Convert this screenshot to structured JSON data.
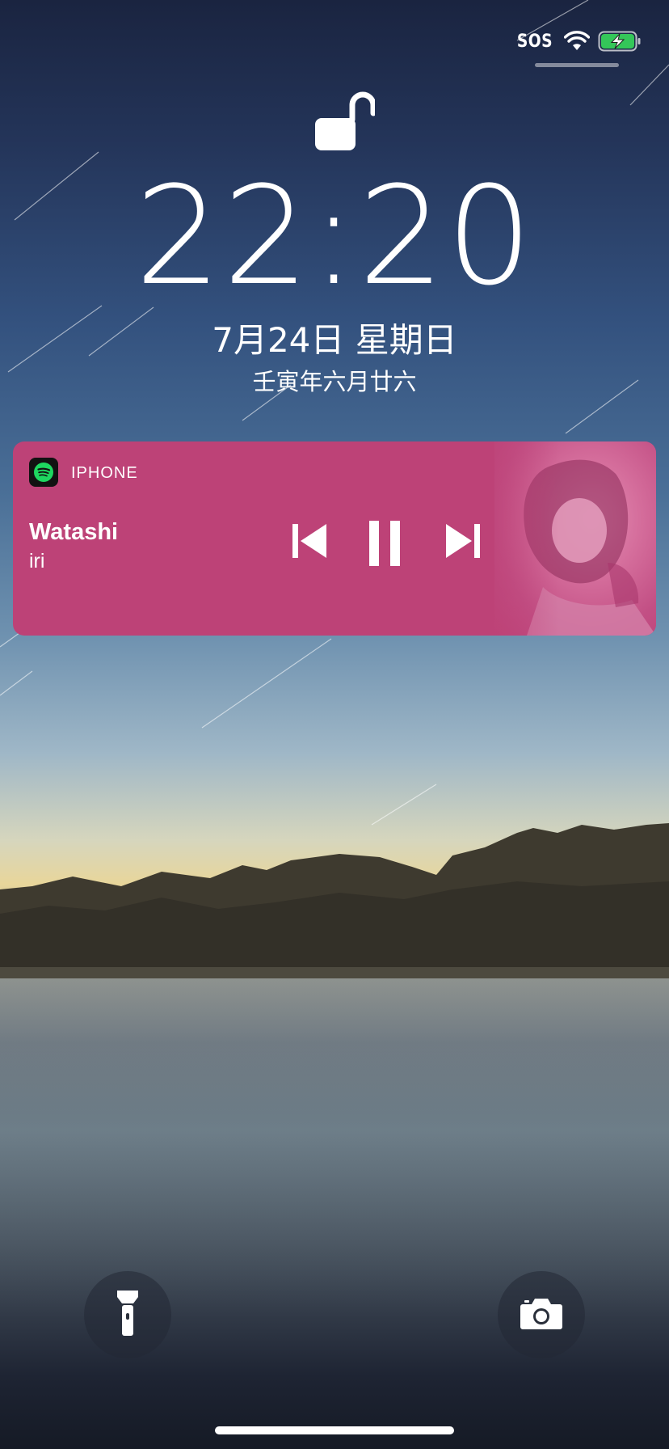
{
  "status_bar": {
    "carrier_text": "SOS",
    "wifi_icon": "wifi-icon",
    "battery_icon": "battery-charging-icon",
    "battery_color": "#34c759"
  },
  "lock_screen": {
    "lock_icon": "unlocked-padlock-icon",
    "time": "22:20",
    "date": "7月24日 星期日",
    "lunar_date": "壬寅年六月廿六"
  },
  "now_playing": {
    "app_icon": "spotify-icon",
    "source": "IPHONE",
    "title": "Watashi",
    "artist": "iri",
    "accent_color": "#bd4277",
    "controls": {
      "previous": "previous-track-icon",
      "pause": "pause-icon",
      "next": "next-track-icon"
    }
  },
  "quick_actions": {
    "flashlight": "flashlight-icon",
    "camera": "camera-icon"
  }
}
